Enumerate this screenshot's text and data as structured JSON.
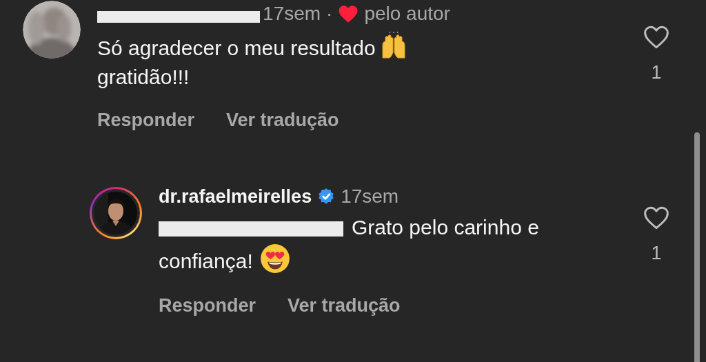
{
  "comments": [
    {
      "kind": "comment",
      "time": "17sem",
      "separator": "·",
      "liked_by_author": true,
      "author_like_label": "pelo autor",
      "text": "Só agradecer o meu resultado",
      "text_2": "gratidão!!!",
      "actions": [
        "Responder",
        "Ver tradução"
      ],
      "liked": false,
      "like_count": "1"
    },
    {
      "kind": "reply",
      "username": "dr.rafaelmeirelles",
      "verified": true,
      "time": "17sem",
      "text": "Grato pelo carinho e",
      "text_2": "confiança!",
      "actions": [
        "Responder",
        "Ver tradução"
      ],
      "liked": false,
      "like_count": "1"
    }
  ]
}
